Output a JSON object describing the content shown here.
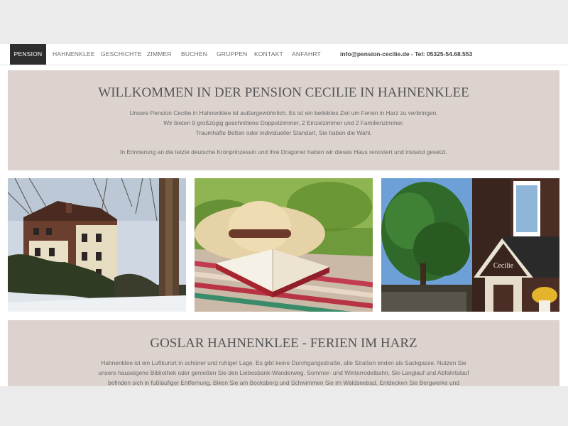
{
  "nav": {
    "items": [
      "PENSION",
      "HAHNENKLEE",
      "GESCHICHTE",
      "ZIMMER",
      "BUCHEN",
      "GRUPPEN",
      "KONTAKT",
      "ANFAHRT"
    ],
    "contact": "info@pension-cecilie.de - Tel: 05325-54.68.553"
  },
  "intro": {
    "title": "WILLKOMMEN IN DER PENSION CECILIE IN HAHNENKLEE",
    "lines": [
      "Unsere Pension Cecilie in Hahnenklee ist außergewöhnlich. Es ist ein beliebtes Ziel um Ferien in Harz zu verbringen.",
      "Wir bieten 9 großzügig geschnittene Doppelzimmer, 2 Einzelzimmer und 2 Familienzimmer.",
      "Traumhafte Betten oder individueller Standart, Sie haben die Wahl.",
      "In Erinnerung an die letzte deutsche Kronprinzessin und ihre Dragoner haben wir dieses Haus renoviert und instand gesetzt."
    ]
  },
  "gallery": {
    "sign_text": "Cecilie"
  },
  "section2": {
    "title": "GOSLAR HAHNENKLEE - FERIEN IM HARZ",
    "lines": [
      "Hahnenklee ist ein Luftkurort in schöner und ruhiger Lage. Es gibt keine Durchgangsstraße, alle Straßen enden als Sackgasse. Nutzen Sie",
      "unsere hauseigene Bibliothek oder genießen Sie den Liebesbank-Wanderweg. Sommer- und Winterrodelbahn, Ski-Langlauf und Abfahrtslauf",
      "befinden sich in fußläufiger Entfernung. Biken Sie am Bocksberg und Schwimmen Sie im Waldseebad. Entdecken Sie Bergwerke und"
    ]
  }
}
